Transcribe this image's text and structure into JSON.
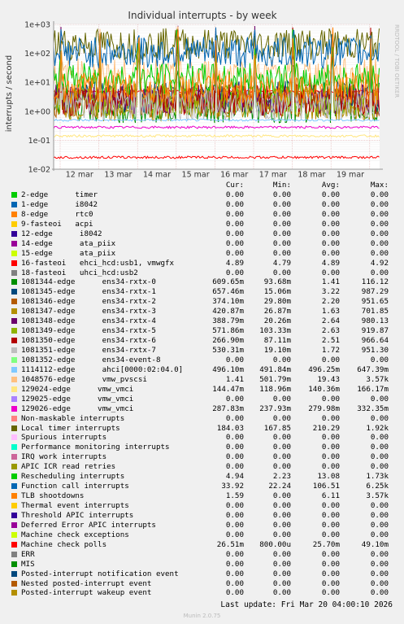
{
  "title": "Individual interrupts - by week",
  "side_label": "RRDTOOL / TOBI OETIKER",
  "footer": "Last update: Fri Mar 20 04:00:10 2026",
  "version": "Munin 2.0.75",
  "legend_headers": {
    "cur": "Cur:",
    "min": "Min:",
    "avg": "Avg:",
    "max": "Max:"
  },
  "chart_data": {
    "type": "line",
    "title": "Individual interrupts - by week",
    "ylabel": "interrupts / second",
    "yscale": "log",
    "ylim": [
      0.01,
      1000
    ],
    "yticks": [
      "1e-02",
      "1e-01",
      "1e+00",
      "1e+01",
      "1e+02",
      "1e+03"
    ],
    "x_categories": [
      "12 mar",
      "13 mar",
      "14 mar",
      "15 mar",
      "16 mar",
      "17 mar",
      "18 mar",
      "19 mar"
    ],
    "grid": true,
    "series": [
      {
        "name": "2-edge      timer",
        "color": "#00cc00",
        "cur": "0.00",
        "min": "0.00",
        "avg": "0.00",
        "max": "0.00"
      },
      {
        "name": "1-edge      i8042",
        "color": "#0066b3",
        "cur": "0.00",
        "min": "0.00",
        "avg": "0.00",
        "max": "0.00"
      },
      {
        "name": "8-edge      rtc0",
        "color": "#ff8000",
        "cur": "0.00",
        "min": "0.00",
        "avg": "0.00",
        "max": "0.00"
      },
      {
        "name": "9-fasteoi   acpi",
        "color": "#ffcc00",
        "cur": "0.00",
        "min": "0.00",
        "avg": "0.00",
        "max": "0.00"
      },
      {
        "name": "12-edge      i8042",
        "color": "#330099",
        "cur": "0.00",
        "min": "0.00",
        "avg": "0.00",
        "max": "0.00"
      },
      {
        "name": "14-edge      ata_piix",
        "color": "#990099",
        "cur": "0.00",
        "min": "0.00",
        "avg": "0.00",
        "max": "0.00"
      },
      {
        "name": "15-edge      ata_piix",
        "color": "#ccff00",
        "cur": "0.00",
        "min": "0.00",
        "avg": "0.00",
        "max": "0.00"
      },
      {
        "name": "16-fasteoi   ehci_hcd:usb1, vmwgfx",
        "color": "#ff0000",
        "cur": "4.89",
        "min": "4.79",
        "avg": "4.89",
        "max": "4.92"
      },
      {
        "name": "18-fasteoi   uhci_hcd:usb2",
        "color": "#808080",
        "cur": "0.00",
        "min": "0.00",
        "avg": "0.00",
        "max": "0.00"
      },
      {
        "name": "1081344-edge      ens34-rxtx-0",
        "color": "#008f00",
        "cur": "609.65m",
        "min": "93.68m",
        "avg": "1.41",
        "max": "116.12"
      },
      {
        "name": "1081345-edge      ens34-rxtx-1",
        "color": "#00487d",
        "cur": "657.46m",
        "min": "15.06m",
        "avg": "3.22",
        "max": "987.29"
      },
      {
        "name": "1081346-edge      ens34-rxtx-2",
        "color": "#b35a00",
        "cur": "374.10m",
        "min": "29.80m",
        "avg": "2.20",
        "max": "951.65"
      },
      {
        "name": "1081347-edge      ens34-rxtx-3",
        "color": "#b38f00",
        "cur": "420.87m",
        "min": "26.87m",
        "avg": "1.63",
        "max": "701.85"
      },
      {
        "name": "1081348-edge      ens34-rxtx-4",
        "color": "#6b006b",
        "cur": "388.79m",
        "min": "20.26m",
        "avg": "2.64",
        "max": "980.13"
      },
      {
        "name": "1081349-edge      ens34-rxtx-5",
        "color": "#8fb300",
        "cur": "571.86m",
        "min": "103.33m",
        "avg": "2.63",
        "max": "919.87"
      },
      {
        "name": "1081350-edge      ens34-rxtx-6",
        "color": "#b30000",
        "cur": "266.90m",
        "min": "87.11m",
        "avg": "2.51",
        "max": "966.64"
      },
      {
        "name": "1081351-edge      ens34-rxtx-7",
        "color": "#bebebe",
        "cur": "530.31m",
        "min": "19.10m",
        "avg": "1.72",
        "max": "951.30"
      },
      {
        "name": "1081352-edge      ens34-event-8",
        "color": "#80ff80",
        "cur": "0.00",
        "min": "0.00",
        "avg": "0.00",
        "max": "0.00"
      },
      {
        "name": "1114112-edge      ahci[0000:02:04.0]",
        "color": "#80c9ff",
        "cur": "496.10m",
        "min": "491.84m",
        "avg": "496.25m",
        "max": "647.39m"
      },
      {
        "name": "1048576-edge      vmw_pvscsi",
        "color": "#ffc080",
        "cur": "1.41",
        "min": "501.79m",
        "avg": "19.43",
        "max": "3.57k"
      },
      {
        "name": "129024-edge      vmw_vmci",
        "color": "#ffe680",
        "cur": "144.47m",
        "min": "118.96m",
        "avg": "140.36m",
        "max": "166.17m"
      },
      {
        "name": "129025-edge      vmw_vmci",
        "color": "#aa80ff",
        "cur": "0.00",
        "min": "0.00",
        "avg": "0.00",
        "max": "0.00"
      },
      {
        "name": "129026-edge      vmw_vmci",
        "color": "#ee00cc",
        "cur": "287.83m",
        "min": "237.93m",
        "avg": "279.98m",
        "max": "332.35m"
      },
      {
        "name": "Non-maskable interrupts",
        "color": "#ff8080",
        "cur": "0.00",
        "min": "0.00",
        "avg": "0.00",
        "max": "0.00"
      },
      {
        "name": "Local timer interrupts",
        "color": "#666600",
        "cur": "184.03",
        "min": "167.85",
        "avg": "210.29",
        "max": "1.92k"
      },
      {
        "name": "Spurious interrupts",
        "color": "#ffbfff",
        "cur": "0.00",
        "min": "0.00",
        "avg": "0.00",
        "max": "0.00"
      },
      {
        "name": "Performance monitoring interrupts",
        "color": "#00ffcc",
        "cur": "0.00",
        "min": "0.00",
        "avg": "0.00",
        "max": "0.00"
      },
      {
        "name": "IRQ work interrupts",
        "color": "#cc6699",
        "cur": "0.00",
        "min": "0.00",
        "avg": "0.00",
        "max": "0.00"
      },
      {
        "name": "APIC ICR read retries",
        "color": "#999900",
        "cur": "0.00",
        "min": "0.00",
        "avg": "0.00",
        "max": "0.00"
      },
      {
        "name": "Rescheduling interrupts",
        "color": "#00cc00",
        "cur": "4.94",
        "min": "2.23",
        "avg": "13.08",
        "max": "1.73k"
      },
      {
        "name": "Function call interrupts",
        "color": "#0066b3",
        "cur": "33.92",
        "min": "22.24",
        "avg": "106.51",
        "max": "6.25k"
      },
      {
        "name": "TLB shootdowns",
        "color": "#ff8000",
        "cur": "1.59",
        "min": "0.00",
        "avg": "6.11",
        "max": "3.57k"
      },
      {
        "name": "Thermal event interrupts",
        "color": "#ffcc00",
        "cur": "0.00",
        "min": "0.00",
        "avg": "0.00",
        "max": "0.00"
      },
      {
        "name": "Threshold APIC interrupts",
        "color": "#330099",
        "cur": "0.00",
        "min": "0.00",
        "avg": "0.00",
        "max": "0.00"
      },
      {
        "name": "Deferred Error APIC interrupts",
        "color": "#990099",
        "cur": "0.00",
        "min": "0.00",
        "avg": "0.00",
        "max": "0.00"
      },
      {
        "name": "Machine check exceptions",
        "color": "#ccff00",
        "cur": "0.00",
        "min": "0.00",
        "avg": "0.00",
        "max": "0.00"
      },
      {
        "name": "Machine check polls",
        "color": "#ff0000",
        "cur": "26.51m",
        "min": "800.00u",
        "avg": "25.70m",
        "max": "49.10m"
      },
      {
        "name": "ERR",
        "color": "#808080",
        "cur": "0.00",
        "min": "0.00",
        "avg": "0.00",
        "max": "0.00"
      },
      {
        "name": "MIS",
        "color": "#008f00",
        "cur": "0.00",
        "min": "0.00",
        "avg": "0.00",
        "max": "0.00"
      },
      {
        "name": "Posted-interrupt notification event",
        "color": "#00487d",
        "cur": "0.00",
        "min": "0.00",
        "avg": "0.00",
        "max": "0.00"
      },
      {
        "name": "Nested posted-interrupt event",
        "color": "#b35a00",
        "cur": "0.00",
        "min": "0.00",
        "avg": "0.00",
        "max": "0.00"
      },
      {
        "name": "Posted-interrupt wakeup event",
        "color": "#b38f00",
        "cur": "0.00",
        "min": "0.00",
        "avg": "0.00",
        "max": "0.00"
      }
    ]
  }
}
